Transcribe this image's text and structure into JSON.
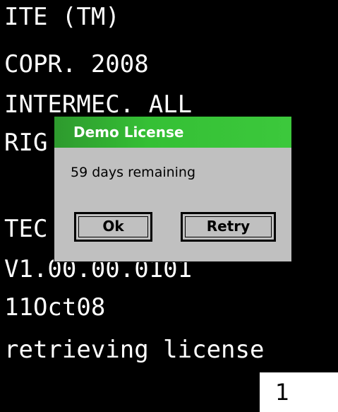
{
  "terminal": {
    "lines": [
      "ITE (TM)",
      "COPR. 2008",
      "INTERMEC. ALL",
      "RIG",
      "",
      "TEC",
      "V1.00.00.0101",
      "11Oct08",
      "retrieving license"
    ]
  },
  "page_indicator": "1",
  "dialog": {
    "title": "Demo License",
    "message": "59 days remaining",
    "ok_label": "Ok",
    "retry_label": "Retry"
  },
  "colors": {
    "background": "#000000",
    "dialog_body": "#c0c0c0",
    "title_bar": "#35c035"
  }
}
